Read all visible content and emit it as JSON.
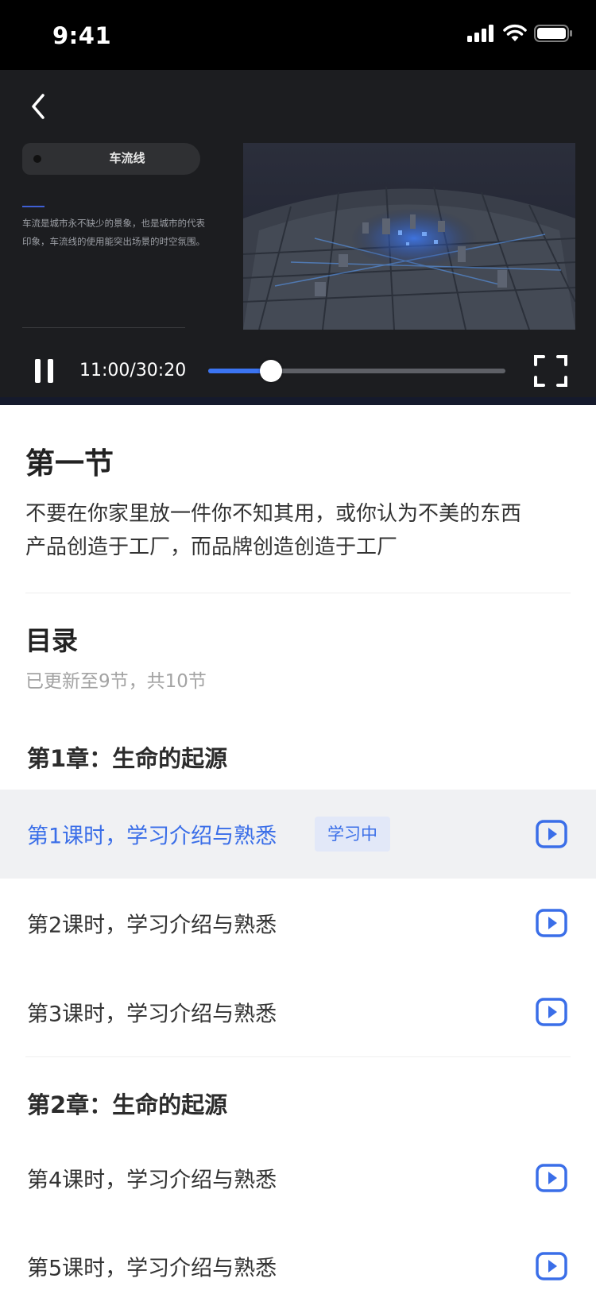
{
  "status_bar": {
    "time": "9:41"
  },
  "video": {
    "slide_title": "车流线",
    "slide_description": "车流是城市永不缺少的景象，也是城市的代表印象，车流线的使用能突出场景的时空氛围。",
    "time_display": "11:00/30:20",
    "progress_fraction": 0.211,
    "accent_color": "#3b74f2"
  },
  "section": {
    "title": "第一节",
    "description_line1": "不要在你家里放一件你不知其用，或你认为不美的东西",
    "description_line2": "产品创造于工厂，而品牌创造创造于工厂"
  },
  "catalog": {
    "title": "目录",
    "subtitle": "已更新至9节，共10节",
    "chapters": [
      {
        "title": "第1章：生命的起源",
        "lessons": [
          {
            "label": "第1课时，学习介绍与熟悉",
            "badge": "学习中",
            "active": true
          },
          {
            "label": "第2课时，学习介绍与熟悉"
          },
          {
            "label": "第3课时，学习介绍与熟悉"
          }
        ]
      },
      {
        "title": "第2章：生命的起源",
        "lessons": [
          {
            "label": "第4课时，学习介绍与熟悉"
          },
          {
            "label": "第5课时，学习介绍与熟悉"
          }
        ]
      }
    ]
  },
  "icons": {
    "back": "chevron-left-icon",
    "pause": "pause-icon",
    "fullscreen": "fullscreen-icon",
    "play": "play-circle-icon"
  }
}
